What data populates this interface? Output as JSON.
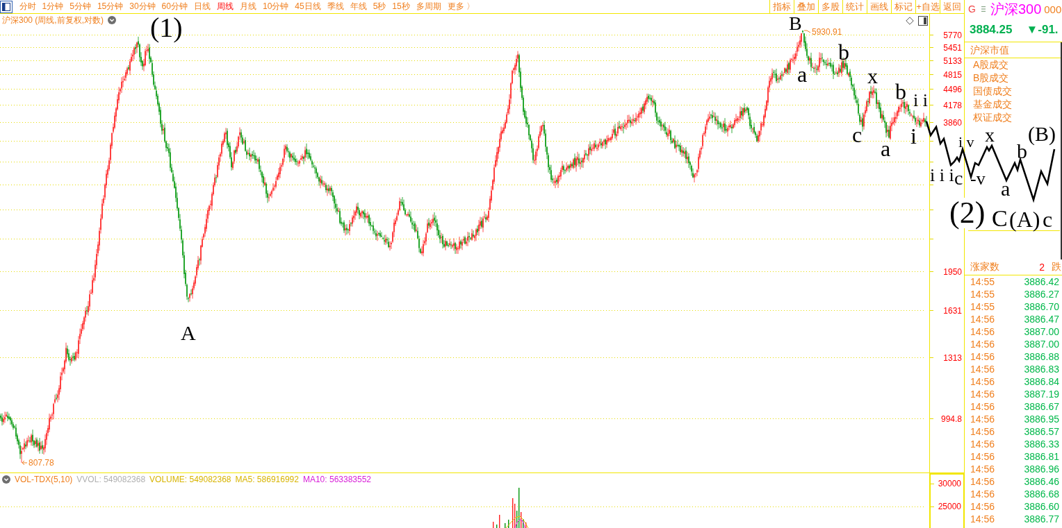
{
  "toolbar": {
    "periods": [
      {
        "label": "分时",
        "selected": false
      },
      {
        "label": "1分钟",
        "selected": false
      },
      {
        "label": "5分钟",
        "selected": false
      },
      {
        "label": "15分钟",
        "selected": false
      },
      {
        "label": "30分钟",
        "selected": false
      },
      {
        "label": "60分钟",
        "selected": false
      },
      {
        "label": "日线",
        "selected": false
      },
      {
        "label": "周线",
        "selected": true
      },
      {
        "label": "月线",
        "selected": false
      },
      {
        "label": "10分钟",
        "selected": false
      },
      {
        "label": "45日线",
        "selected": false
      },
      {
        "label": "季线",
        "selected": false
      },
      {
        "label": "年线",
        "selected": false
      },
      {
        "label": "5秒",
        "selected": false
      },
      {
        "label": "15秒",
        "selected": false
      },
      {
        "label": "多周期",
        "selected": false
      }
    ],
    "more": "更多 〉",
    "actions": [
      "指标",
      "叠加",
      "多股",
      "统计",
      "画线",
      "标记",
      "+自选",
      "返回"
    ]
  },
  "chart": {
    "title": "沪深300 (周线,前复权,对数)",
    "axis_labels": [
      "5770",
      "5451",
      "5133",
      "4815",
      "4496",
      "4178",
      "3860",
      "1950",
      "1631",
      "1313",
      "994.8"
    ],
    "high_marker": "5930.91",
    "low_marker": "807.78",
    "wave_labels": [
      "(1)",
      "A",
      "B",
      "a",
      "b",
      "x",
      "c",
      "a",
      "b",
      "i",
      "i i"
    ]
  },
  "wave_drawing": {
    "labels": [
      "i v",
      "x",
      "(B)",
      "i i i",
      "c",
      "-v",
      "b",
      "a",
      "(2)",
      "C",
      "(A)",
      "c"
    ]
  },
  "volume": {
    "indicator": "VOL-TDX(5,10)",
    "vvol": "VVOL: 549082368",
    "volume": "VOLUME: 549082368",
    "ma5": "MA5: 586916992",
    "ma10": "MA10: 563383552",
    "axis_labels": [
      "30000",
      "25000"
    ]
  },
  "quote": {
    "market": "G",
    "name": "沪深300",
    "code": "000",
    "price": "3884.25",
    "change": "▼-91.",
    "section": "沪深市值",
    "items": [
      "A股成交",
      "B股成交",
      "国债成交",
      "基金成交",
      "权证成交"
    ],
    "breadth": {
      "label": "涨家数",
      "value": "2",
      "label_2": "跌"
    },
    "ticks": [
      {
        "time": "14:55",
        "price": "3886.42"
      },
      {
        "time": "14:55",
        "price": "3886.27"
      },
      {
        "time": "14:55",
        "price": "3886.70"
      },
      {
        "time": "14:56",
        "price": "3886.47"
      },
      {
        "time": "14:56",
        "price": "3887.00"
      },
      {
        "time": "14:56",
        "price": "3887.00"
      },
      {
        "time": "14:56",
        "price": "3886.88"
      },
      {
        "time": "14:56",
        "price": "3886.83"
      },
      {
        "time": "14:56",
        "price": "3886.84"
      },
      {
        "time": "14:56",
        "price": "3887.19"
      },
      {
        "time": "14:56",
        "price": "3886.67"
      },
      {
        "time": "14:56",
        "price": "3886.95"
      },
      {
        "time": "14:56",
        "price": "3886.57"
      },
      {
        "time": "14:56",
        "price": "3886.33"
      },
      {
        "time": "14:56",
        "price": "3886.81"
      },
      {
        "time": "14:56",
        "price": "3886.96"
      },
      {
        "time": "14:56",
        "price": "3886.46"
      },
      {
        "time": "14:56",
        "price": "3886.68"
      },
      {
        "time": "14:56",
        "price": "3886.60"
      },
      {
        "time": "14:56",
        "price": "3886.77"
      }
    ]
  }
}
